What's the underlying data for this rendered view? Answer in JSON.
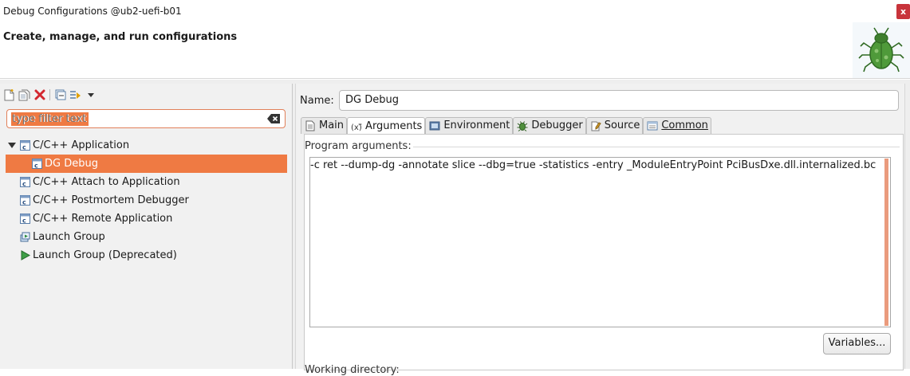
{
  "window": {
    "title": "Debug Configurations @ub2-uefi-b01",
    "close_glyph": "x"
  },
  "header": {
    "heading": "Create, manage, and run configurations",
    "badge_icon": "bug-icon"
  },
  "left": {
    "filter": {
      "placeholder": "type filter text"
    },
    "toolbar_icons": [
      "new-config-icon",
      "duplicate-icon",
      "delete-icon",
      "collapse-all-icon",
      "filter-icon",
      "dropdown-arrow-icon"
    ],
    "tree": [
      {
        "label": "C/C++ Application",
        "icon": "c-config-icon",
        "expanded": true
      },
      {
        "label": "DG Debug",
        "icon": "c-config-icon",
        "selected": true
      },
      {
        "label": "C/C++ Attach to Application",
        "icon": "c-config-icon"
      },
      {
        "label": "C/C++ Postmortem Debugger",
        "icon": "c-config-icon"
      },
      {
        "label": "C/C++ Remote Application",
        "icon": "c-config-icon"
      },
      {
        "label": "Launch Group",
        "icon": "launch-group-icon"
      },
      {
        "label": "Launch Group (Deprecated)",
        "icon": "run-icon"
      }
    ]
  },
  "right": {
    "name_label": "Name:",
    "name_value": "DG Debug",
    "tabs": [
      {
        "label": "Main",
        "icon": "document-icon"
      },
      {
        "label": "Arguments",
        "icon": "variable-icon",
        "active": true
      },
      {
        "label": "Environment",
        "icon": "environment-icon"
      },
      {
        "label": "Debugger",
        "icon": "bug-icon"
      },
      {
        "label": "Source",
        "icon": "source-icon"
      },
      {
        "label": "Common",
        "icon": "common-icon"
      }
    ],
    "program_args_label": "Program arguments:",
    "program_args": "-c ret --dump-dg -annotate slice --dbg=true -statistics -entry _ModuleEntryPoint PciBusDxe.dll.internalized.bc",
    "variables_button": "Variables...",
    "working_dir_label": "Working directory:"
  },
  "colors": {
    "selection": "#ef7a43",
    "close": "#c8343b"
  }
}
